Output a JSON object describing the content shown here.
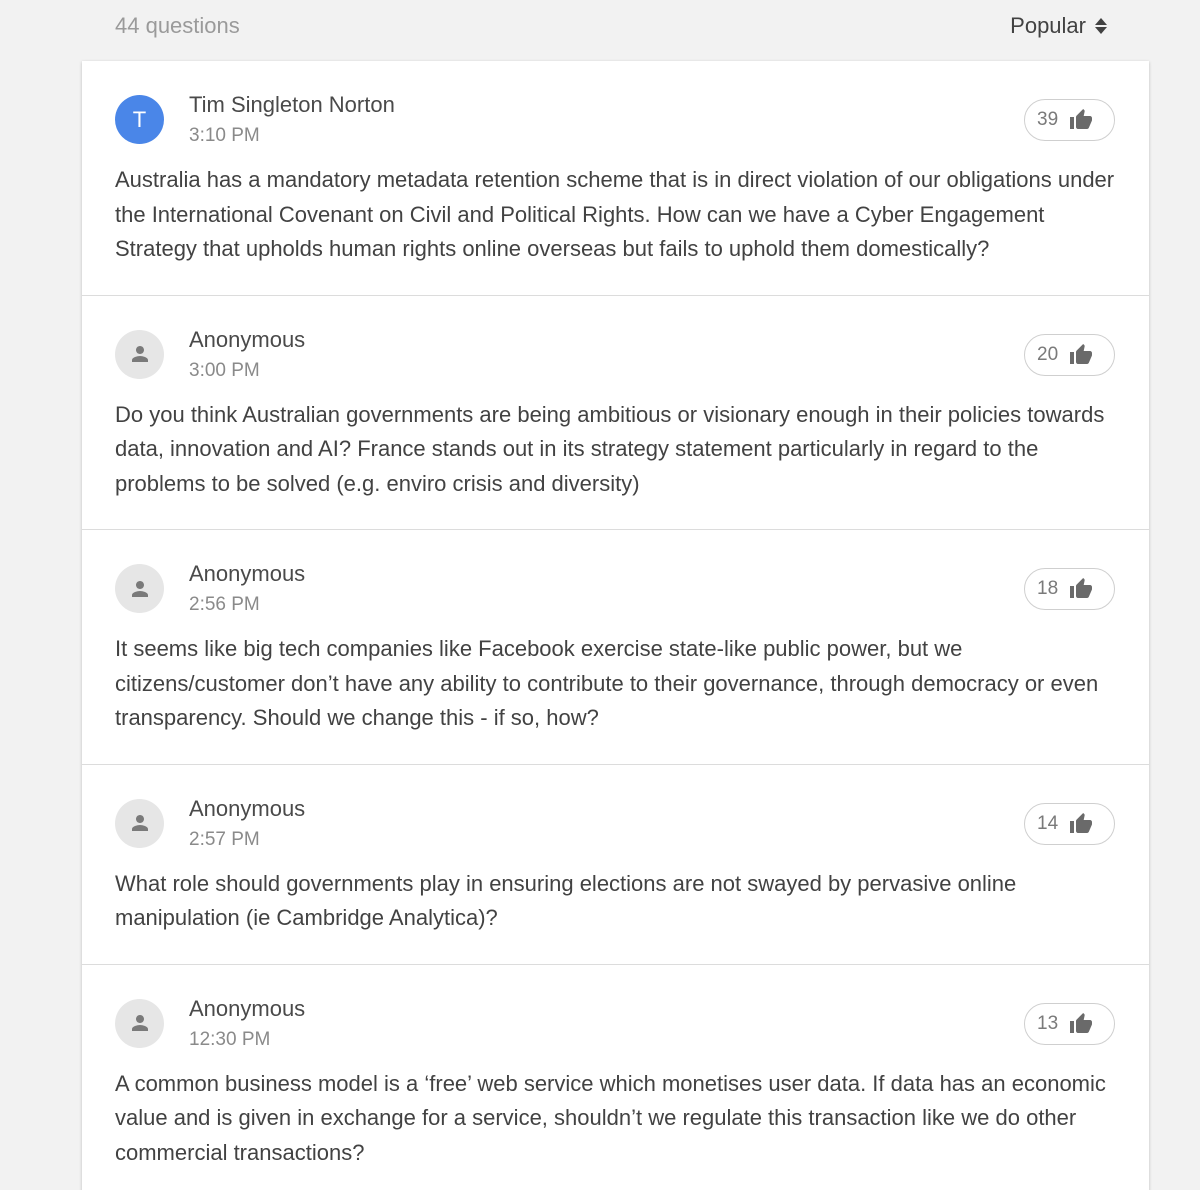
{
  "header": {
    "count_label": "44 questions",
    "sort_label": "Popular",
    "sort_icon": "sort-updown-icon"
  },
  "colors": {
    "initial_avatar_bg": "#4a86e8",
    "anon_avatar_bg": "#e6e6e6"
  },
  "questions": [
    {
      "author": "Tim Singleton Norton",
      "initial": "T",
      "time": "3:10 PM",
      "votes": "39",
      "text": "Australia has a mandatory metadata retention scheme that is in direct violation of our obligations under the International Covenant on Civil and Political Rights. How can we have a Cyber Engagement Strategy that upholds human rights online overseas but fails to uphold them domestically?"
    },
    {
      "author": "Anonymous",
      "time": "3:00 PM",
      "votes": "20",
      "text": "Do you think Australian governments are being ambitious or visionary enough in their policies towards data, innovation and AI? France stands out in its strategy statement particularly in regard to the problems to be solved (e.g. enviro crisis and diversity)"
    },
    {
      "author": "Anonymous",
      "time": "2:56 PM",
      "votes": "18",
      "text": "It seems like big tech companies like Facebook exercise state-like public power, but we citizens/customer don’t have any ability to contribute to their governance, through democracy or even transparency. Should we change this - if so, how?"
    },
    {
      "author": "Anonymous",
      "time": "2:57 PM",
      "votes": "14",
      "text": "What role should governments play in ensuring elections are not swayed by pervasive online manipulation (ie Cambridge Analytica)?"
    },
    {
      "author": "Anonymous",
      "time": "12:30 PM",
      "votes": "13",
      "text": "A common business model is a ‘free’ web service which monetises user data. If data has an economic value and is given in exchange for a service, shouldn’t we regulate this transaction like we do other commercial transactions?"
    }
  ]
}
